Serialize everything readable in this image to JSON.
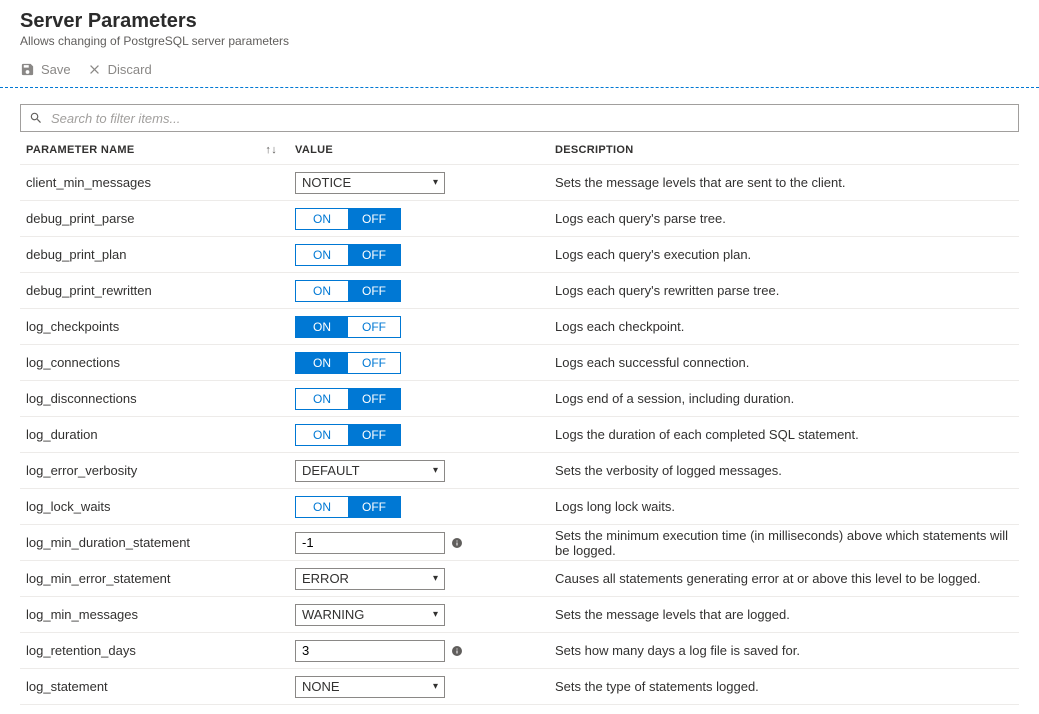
{
  "header": {
    "title": "Server Parameters",
    "subtitle": "Allows changing of PostgreSQL server parameters"
  },
  "toolbar": {
    "save": "Save",
    "discard": "Discard"
  },
  "search": {
    "placeholder": "Search to filter items..."
  },
  "columns": {
    "name": "Parameter Name",
    "value": "Value",
    "description": "Description"
  },
  "toggle_labels": {
    "on": "ON",
    "off": "OFF"
  },
  "rows": [
    {
      "name": "client_min_messages",
      "type": "dropdown",
      "value": "NOTICE",
      "desc": "Sets the message levels that are sent to the client."
    },
    {
      "name": "debug_print_parse",
      "type": "toggle",
      "value": "OFF",
      "desc": "Logs each query's parse tree."
    },
    {
      "name": "debug_print_plan",
      "type": "toggle",
      "value": "OFF",
      "desc": "Logs each query's execution plan."
    },
    {
      "name": "debug_print_rewritten",
      "type": "toggle",
      "value": "OFF",
      "desc": "Logs each query's rewritten parse tree."
    },
    {
      "name": "log_checkpoints",
      "type": "toggle",
      "value": "ON",
      "desc": "Logs each checkpoint."
    },
    {
      "name": "log_connections",
      "type": "toggle",
      "value": "ON",
      "desc": "Logs each successful connection."
    },
    {
      "name": "log_disconnections",
      "type": "toggle",
      "value": "OFF",
      "desc": "Logs end of a session, including duration."
    },
    {
      "name": "log_duration",
      "type": "toggle",
      "value": "OFF",
      "desc": "Logs the duration of each completed SQL statement."
    },
    {
      "name": "log_error_verbosity",
      "type": "dropdown",
      "value": "DEFAULT",
      "desc": "Sets the verbosity of logged messages."
    },
    {
      "name": "log_lock_waits",
      "type": "toggle",
      "value": "OFF",
      "desc": "Logs long lock waits."
    },
    {
      "name": "log_min_duration_statement",
      "type": "text",
      "value": "-1",
      "info": true,
      "desc": "Sets the minimum execution time (in milliseconds) above which statements will be logged."
    },
    {
      "name": "log_min_error_statement",
      "type": "dropdown",
      "value": "ERROR",
      "desc": "Causes all statements generating error at or above this level to be logged."
    },
    {
      "name": "log_min_messages",
      "type": "dropdown",
      "value": "WARNING",
      "desc": "Sets the message levels that are logged."
    },
    {
      "name": "log_retention_days",
      "type": "text",
      "value": "3",
      "info": true,
      "desc": "Sets how many days a log file is saved for."
    },
    {
      "name": "log_statement",
      "type": "dropdown",
      "value": "NONE",
      "desc": "Sets the type of statements logged."
    }
  ]
}
